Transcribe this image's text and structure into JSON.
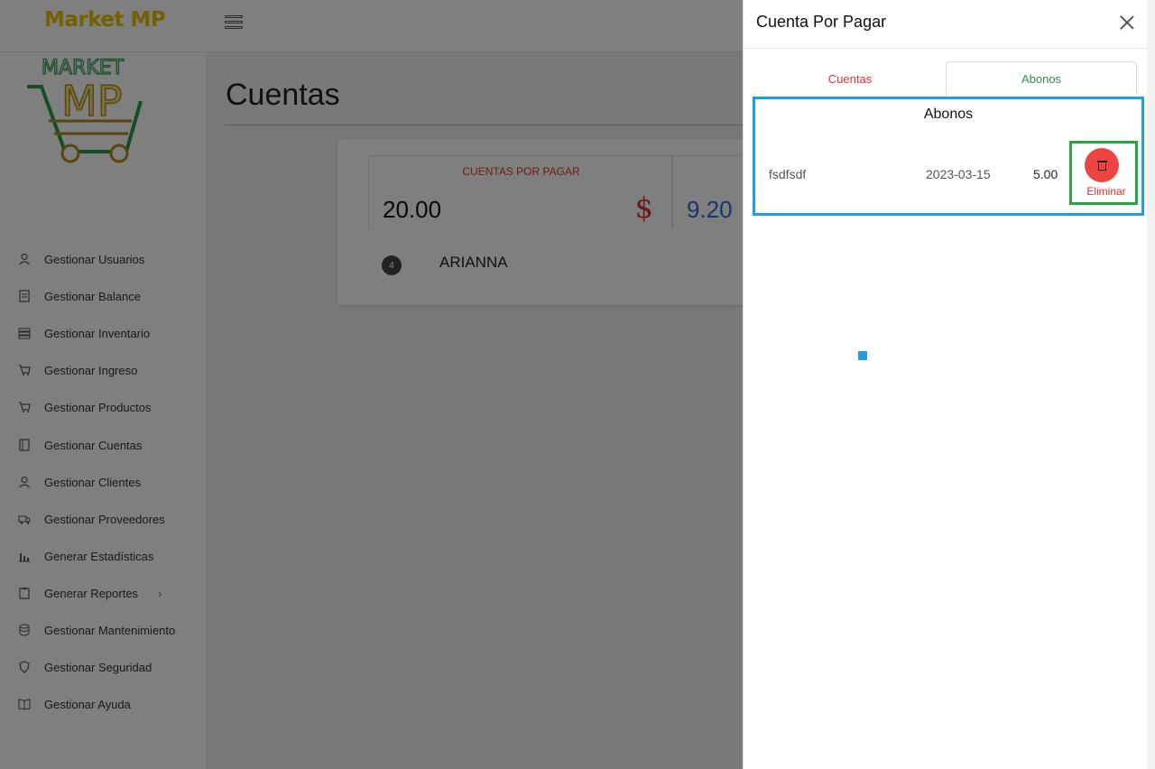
{
  "app": {
    "brand": "Market MP",
    "page_title": "Cuentas"
  },
  "sidebar": {
    "items": [
      {
        "label": "Gestionar Usuarios",
        "icon": "user-icon"
      },
      {
        "label": "Gestionar Balance",
        "icon": "ledger-icon"
      },
      {
        "label": "Gestionar Inventario",
        "icon": "inventory-icon"
      },
      {
        "label": "Gestionar Ingreso",
        "icon": "cart-icon"
      },
      {
        "label": "Gestionar Productos",
        "icon": "cart-icon"
      },
      {
        "label": "Gestionar Cuentas",
        "icon": "notebook-icon"
      },
      {
        "label": "Gestionar Clientes",
        "icon": "user-icon"
      },
      {
        "label": "Gestionar Proveedores",
        "icon": "truck-icon"
      },
      {
        "label": "Generar Estadísticas",
        "icon": "bar-chart-icon"
      },
      {
        "label": "Generar Reportes",
        "icon": "clipboard-icon"
      },
      {
        "label": "Gestionar Mantenimiento",
        "icon": "database-icon"
      },
      {
        "label": "Gestionar Seguridad",
        "icon": "shield-icon"
      },
      {
        "label": "Gestionar Ayuda",
        "icon": "book-icon"
      }
    ]
  },
  "summary": {
    "stat1_title": "CUENTAS POR PAGAR",
    "stat1_value": "20.00",
    "stat1_symbol": "$",
    "stat2_value": "9.20",
    "row_badge": "4",
    "row_name": "ARIANNA"
  },
  "drawer": {
    "title": "Cuenta Por Pagar",
    "tabs": {
      "cuentas": "Cuentas",
      "abonos": "Abonos"
    },
    "abonos": {
      "heading": "Abonos",
      "row": {
        "description": "fsdfsdf",
        "date": "2023-03-15",
        "amount": "5.00",
        "delete_label": "Eliminar"
      }
    }
  },
  "colors": {
    "brand": "#e6c300",
    "danger": "#ef4444",
    "accent_green": "#2f8f4f",
    "highlight_blue": "#1ea0e0",
    "highlight_green": "#24a83f"
  }
}
